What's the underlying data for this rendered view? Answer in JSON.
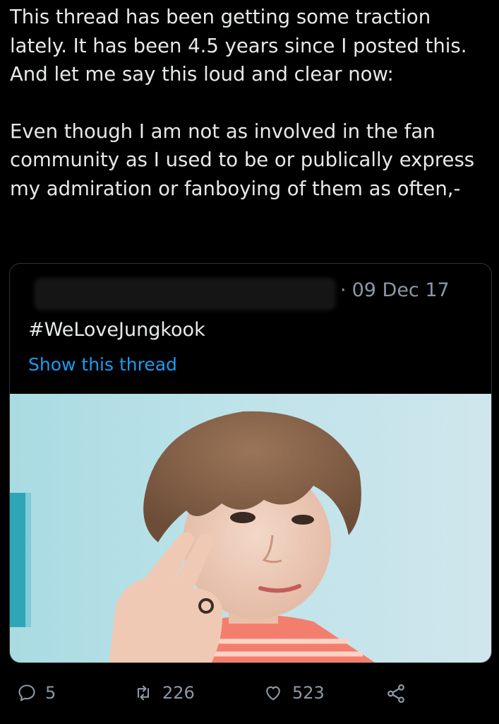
{
  "tweet": {
    "paragraph1": "This thread has been getting some traction lately. It has been 4.5 years since I posted this. And let me say this loud and clear now:",
    "paragraph2": "Even though I am not as involved in the fan community as I used to be or publically express my admiration or fanboying of them as often,-"
  },
  "quote": {
    "date_separator": "·",
    "date": "09 Dec 17",
    "text": "#WeLoveJungkook",
    "show_thread": "Show this thread"
  },
  "actions": {
    "reply_count": "5",
    "retweet_count": "226",
    "like_count": "523",
    "icons": [
      "reply-icon",
      "retweet-icon",
      "like-icon",
      "share-icon"
    ]
  },
  "colors": {
    "background": "#000000",
    "text": "#e7e9ea",
    "secondary": "#8b98a5",
    "link": "#1d9bf0",
    "border": "#2f3336"
  }
}
